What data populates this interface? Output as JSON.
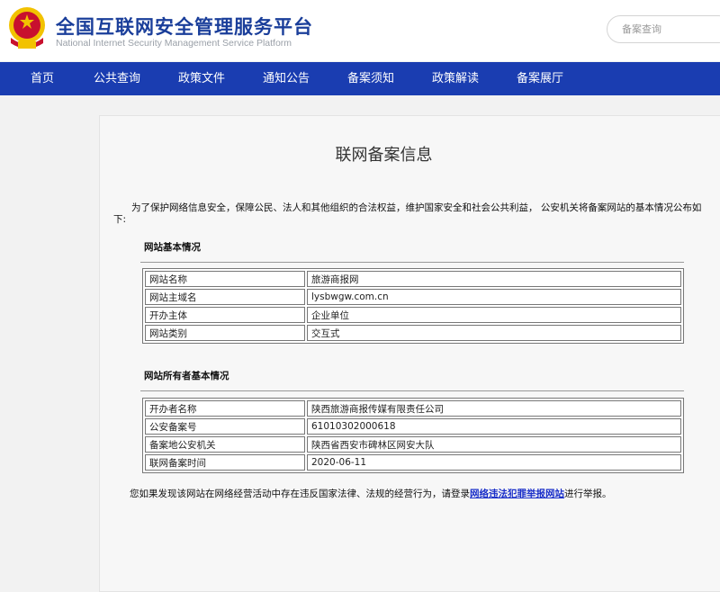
{
  "header": {
    "title": "全国互联网安全管理服务平台",
    "subtitle": "National Internet Security Management Service Platform",
    "search_placeholder": "备案查询"
  },
  "nav": [
    "首页",
    "公共查询",
    "政策文件",
    "通知公告",
    "备案须知",
    "政策解读",
    "备案展厅"
  ],
  "main": {
    "title": "联网备案信息",
    "intro_line1": "为了保护网络信息安全，保障公民、法人和其他组织的合法权益，维护国家安全和社会公共利益， 公安机关将备案网站的基本情况公布如",
    "intro_line2": "下:",
    "section1_title": "网站基本情况",
    "section1_rows": [
      [
        "网站名称",
        "旅游商报网"
      ],
      [
        "网站主域名",
        "lysbwgw.com.cn"
      ],
      [
        "开办主体",
        "企业单位"
      ],
      [
        "网站类别",
        "交互式"
      ]
    ],
    "section2_title": "网站所有者基本情况",
    "section2_rows": [
      [
        "开办者名称",
        "陕西旅游商报传媒有限责任公司"
      ],
      [
        "公安备案号",
        "61010302000618"
      ],
      [
        "备案地公安机关",
        "陕西省西安市碑林区网安大队"
      ],
      [
        "联网备案时间",
        "2020-06-11"
      ]
    ],
    "footer_text": "您如果发现该网站在网络经营活动中存在违反国家法律、法规的经营行为，请登录",
    "footer_link": "网络违法犯罪举报网站",
    "footer_suffix": "进行举报。"
  },
  "colors": {
    "nav_bg": "#1a3db1",
    "title_blue": "#1a3e9a",
    "emblem_red": "#c8102e",
    "emblem_gold": "#f2c200"
  }
}
